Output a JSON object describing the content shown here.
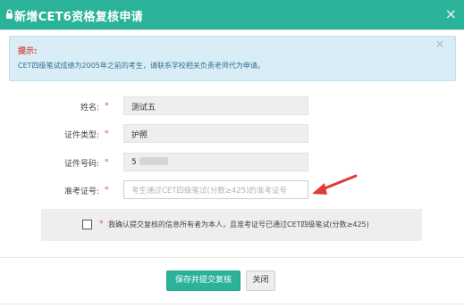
{
  "dialog": {
    "title": "新增CET6资格复核申请",
    "close_glyph": "×"
  },
  "alert": {
    "title": "提示:",
    "message": "CET四级笔试成绩为2005年之前的考生，请联系学校相关负责老师代为申请。",
    "close_glyph": "×"
  },
  "form": {
    "required_mark": "*",
    "name": {
      "label": "姓名:",
      "value": "测试五"
    },
    "id_type": {
      "label": "证件类型:",
      "value": "护照"
    },
    "id_number": {
      "label": "证件号码:",
      "value": "5"
    },
    "ticket": {
      "label": "准考证号:",
      "placeholder": "考生通过CET四级笔试(分数≥425)的准考证号"
    }
  },
  "confirm": {
    "required_mark": "*",
    "text": "我确认提交复核的信息所有者为本人，且准考证号已通过CET四级笔试(分数≥425)"
  },
  "buttons": {
    "submit": "保存并提交复核",
    "close": "关闭"
  },
  "colors": {
    "brand": "#2bb39a",
    "alert_bg": "#d9edf7",
    "alert_title": "#d9534f",
    "alert_text": "#31708f",
    "required": "#d9534f",
    "arrow": "#e03a3a"
  },
  "icons": {
    "title_icon": "lock-icon",
    "dialog_close": "close-icon",
    "alert_close": "close-icon",
    "annotation": "arrow-icon"
  }
}
